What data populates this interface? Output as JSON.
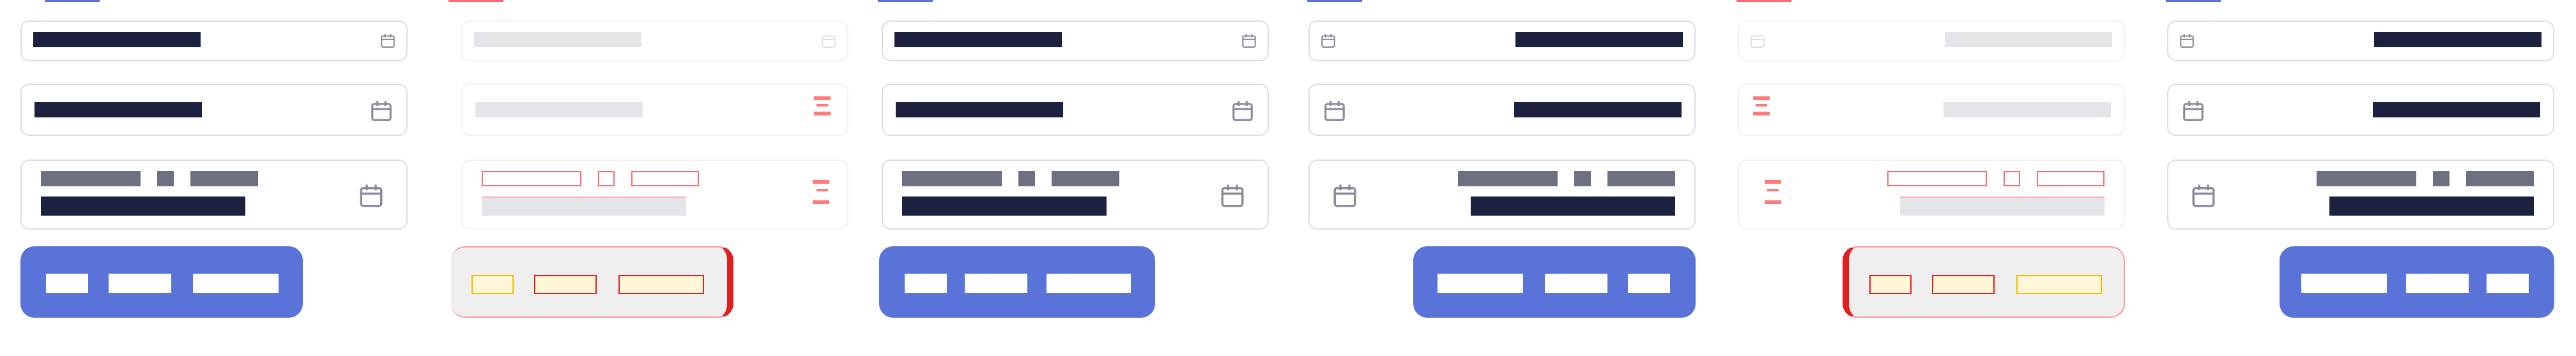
{
  "panels": [
    {
      "id": "ltr-enabled",
      "state": "enabled",
      "direction": "ltr"
    },
    {
      "id": "ltr-disabled",
      "state": "disabled",
      "direction": "ltr"
    },
    {
      "id": "ltr-enabled-2",
      "state": "enabled",
      "direction": "ltr"
    },
    {
      "id": "rtl-enabled",
      "state": "enabled",
      "direction": "rtl"
    },
    {
      "id": "rtl-disabled",
      "state": "disabled",
      "direction": "rtl"
    },
    {
      "id": "rtl-enabled-2",
      "state": "enabled",
      "direction": "rtl"
    }
  ],
  "colors": {
    "accent": "#5a73d8",
    "text_dark": "#1c2140",
    "text_gray": "#6d7080",
    "field_border": "#dcdde3",
    "disabled_fill": "#efefef",
    "error_red": "#e02020"
  },
  "icons": {
    "date_field": "calendar-icon"
  }
}
